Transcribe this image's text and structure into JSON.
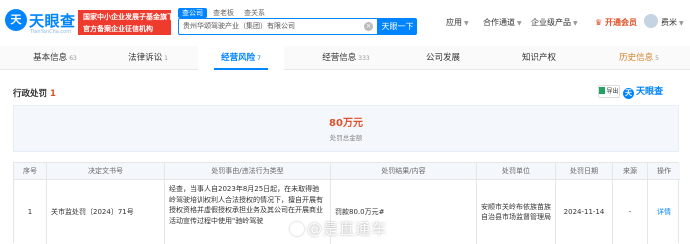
{
  "header": {
    "logo_mark": "天",
    "logo_title": "天眼查",
    "logo_domain": "TianYanCha.com",
    "banner_line1": "国家中小企业发展子基金旗下",
    "banner_line2": "官方备案企业征信机构",
    "search_tabs": [
      "查公司",
      "查老板",
      "查关系"
    ],
    "search_value": "贵州华颂驾驶产业（集团）有限公司",
    "search_button": "天眼一下",
    "nav": [
      "应用",
      "合作通道",
      "企业级产品"
    ],
    "vip_label": "开通会员",
    "user_name": "费米"
  },
  "tabs": [
    {
      "label": "基本信息",
      "count": "63"
    },
    {
      "label": "法律诉讼",
      "count": "1"
    },
    {
      "label": "经营风险",
      "count": "7"
    },
    {
      "label": "经营信息",
      "count": "333"
    },
    {
      "label": "公司发展",
      "count": ""
    },
    {
      "label": "知识产权",
      "count": ""
    },
    {
      "label": "历史信息",
      "count": "5"
    }
  ],
  "section": {
    "title": "行政处罚",
    "count": "1",
    "export_label": "导出",
    "brand": "天眼查"
  },
  "summary": {
    "amount": "80万元",
    "label": "处罚总金额"
  },
  "table": {
    "headers": [
      "序号",
      "决定文书号",
      "处罚事由/违法行为类型",
      "处罚结果/内容",
      "处罚单位",
      "处罚日期",
      "来源",
      "操作"
    ],
    "rows": [
      {
        "index": "1",
        "doc_no": "关市监处罚〔2024〕71号",
        "reason": "经查，当事人自2023年8月25日起，在未取得驰岭驾驶培训权利人合法授权的情况下，擅自开展有授权资格并虚假授权承担业务及其公司在开展商业活动宣传过程中使用\"驰岭驾驶",
        "result": "罚款80.0万元#",
        "unit": "安顺市关岭布依族苗族自治县市场监督管理局",
        "date": "2024-11-14",
        "source": "-",
        "action": "详情"
      }
    ]
  },
  "watermark": "@是直通车"
}
